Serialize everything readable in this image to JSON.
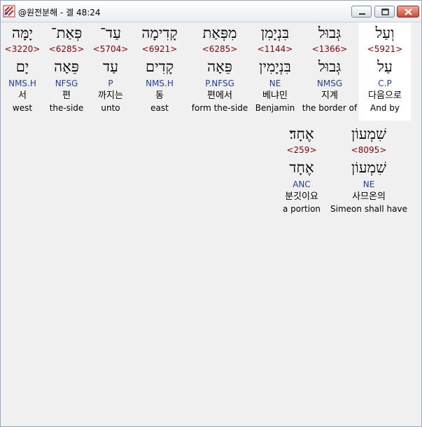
{
  "window": {
    "title": "@원전분해 - 겔 48:24"
  },
  "rows": [
    {
      "words": [
        {
          "hebrew": "וְעַל",
          "strong": "<5921>",
          "lemma": "עַל",
          "morph": "C.P",
          "korean": "다음으로",
          "english": "And by",
          "highlighted": true
        },
        {
          "hebrew": "גְּבוּל",
          "strong": "<1366>",
          "lemma": "גְּבוּל",
          "morph": "NMSG",
          "korean": "지계",
          "english": "the border of"
        },
        {
          "hebrew": "בִּנְיָמִן",
          "strong": "<1144>",
          "lemma": "בִּנְיָמִין",
          "morph": "NE",
          "korean": "베냐민",
          "english": "Benjamin"
        },
        {
          "hebrew": "מִפְּאַת",
          "strong": "<6285>",
          "lemma": "פֵּאָה",
          "morph": "P.NFSG",
          "korean": "편에서",
          "english": "form the-side"
        },
        {
          "hebrew": "קָדִימָה",
          "strong": "<6921>",
          "lemma": "קָדִים",
          "morph": "NMS.H",
          "korean": "동",
          "english": "east"
        },
        {
          "hebrew": "עַד־",
          "strong": "<5704>",
          "lemma": "עַד",
          "morph": "P",
          "korean": "까지는",
          "english": "unto"
        },
        {
          "hebrew": "פְּאַת־",
          "strong": "<6285>",
          "lemma": "פֵּאָה",
          "morph": "NFSG",
          "korean": "편",
          "english": "the-side"
        },
        {
          "hebrew": "יָמָּה",
          "strong": "<3220>",
          "lemma": "יָם",
          "morph": "NMS.H",
          "korean": "서",
          "english": "west"
        }
      ]
    },
    {
      "words": [
        {
          "hebrew": "שִׁמְעוֹן",
          "strong": "<8095>",
          "lemma": "שִׁמְעוֹן",
          "morph": "NE",
          "korean": "사므온의",
          "english": "Simeon shall have"
        },
        {
          "hebrew": "אֶחָד׃",
          "strong": "<259>",
          "lemma": "אֶחָד",
          "morph": "ANC",
          "korean": "분깃이요",
          "english": "a portion"
        }
      ]
    }
  ]
}
